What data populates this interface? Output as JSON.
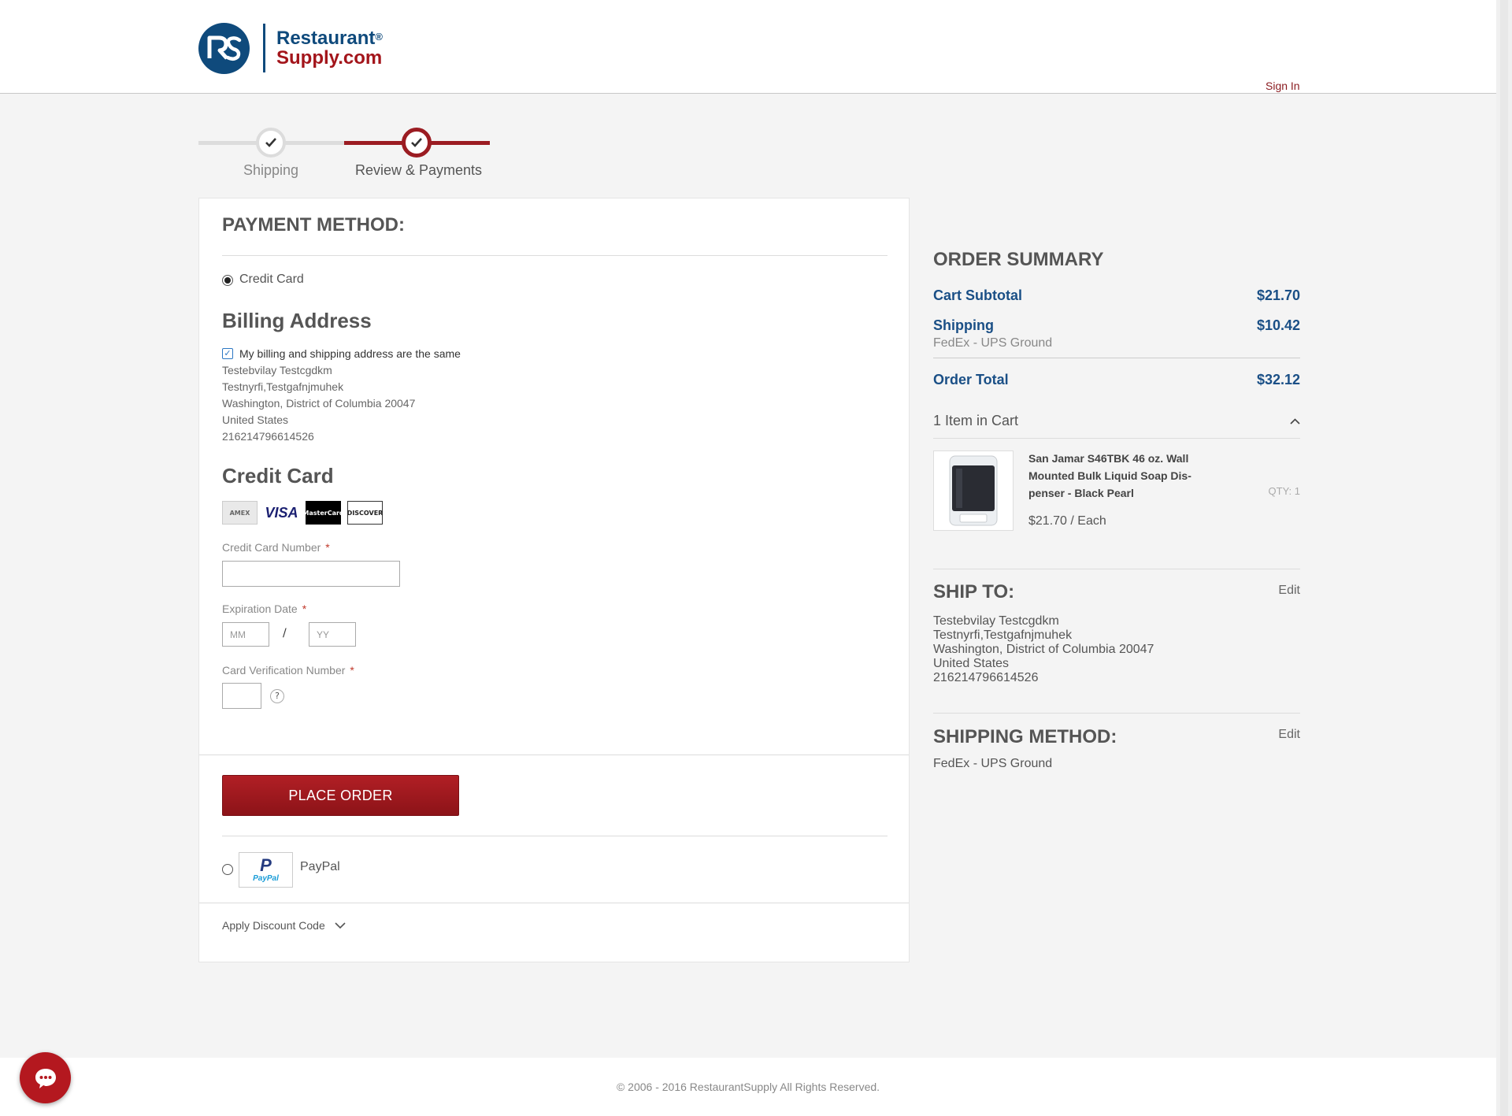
{
  "brand": {
    "line1": "Restaurant",
    "line2": "Supply.com",
    "reg": "®"
  },
  "header": {
    "sign_in": "Sign In"
  },
  "progress": {
    "steps": [
      {
        "label": "Shipping"
      },
      {
        "label": "Review & Payments"
      }
    ]
  },
  "payment": {
    "title": "PAYMENT METHOD:",
    "credit_card_option": "Credit Card",
    "billing_title": "Billing Address",
    "same_address_label": "My billing and shipping address are the same",
    "billing_lines": [
      "Testebvilay Testcgdkm",
      "Testnyrfi,Testgafnjmuhek",
      "Washington, District of Columbia 20047",
      "United States",
      "216214796614526"
    ],
    "credit_card_title": "Credit Card",
    "card_logos": {
      "amex": "AMEX",
      "visa": "VISA",
      "mastercard": "MasterCard",
      "discover": "DISCOVER"
    },
    "card_number_label": "Credit Card Number",
    "expiration_label": "Expiration Date",
    "month_placeholder": "MM",
    "year_placeholder": "YY",
    "slash": "/",
    "cvv_label": "Card Verification Number",
    "cvv_help": "?",
    "required_mark": "*",
    "place_order": "PLACE ORDER",
    "paypal_label": "PayPal",
    "paypal_logo_text": "PayPal",
    "discount_label": "Apply Discount Code"
  },
  "summary": {
    "title": "ORDER SUMMARY",
    "subtotal_label": "Cart Subtotal",
    "subtotal_value": "$21.70",
    "shipping_label": "Shipping",
    "shipping_value": "$10.42",
    "shipping_method": "FedEx - UPS Ground",
    "total_label": "Order Total",
    "total_value": "$32.12",
    "items_label": "1 Item in Cart",
    "item": {
      "name": "San Jamar S46TBK 46 oz. Wall Mounted Bulk Liquid Soap Dis-penser - Black Pearl",
      "qty": "QTY: 1",
      "price": "$21.70 / Each"
    },
    "ship_to_title": "SHIP TO:",
    "edit_label": "Edit",
    "ship_to_lines": [
      "Testebvilay Testcgdkm",
      "Testnyrfi,Testgafnjmuhek",
      "Washington, District of Columbia 20047",
      "United States",
      "216214796614526"
    ],
    "shipping_method_title": "SHIPPING METHOD:",
    "shipping_method_value": "FedEx - UPS Ground"
  },
  "footer": {
    "copyright": "© 2006 - 2016 RestaurantSupply All Rights Reserved."
  },
  "colors": {
    "brand_blue": "#0f4a7c",
    "brand_red": "#a3151b",
    "accent_red": "#9b1c22"
  }
}
